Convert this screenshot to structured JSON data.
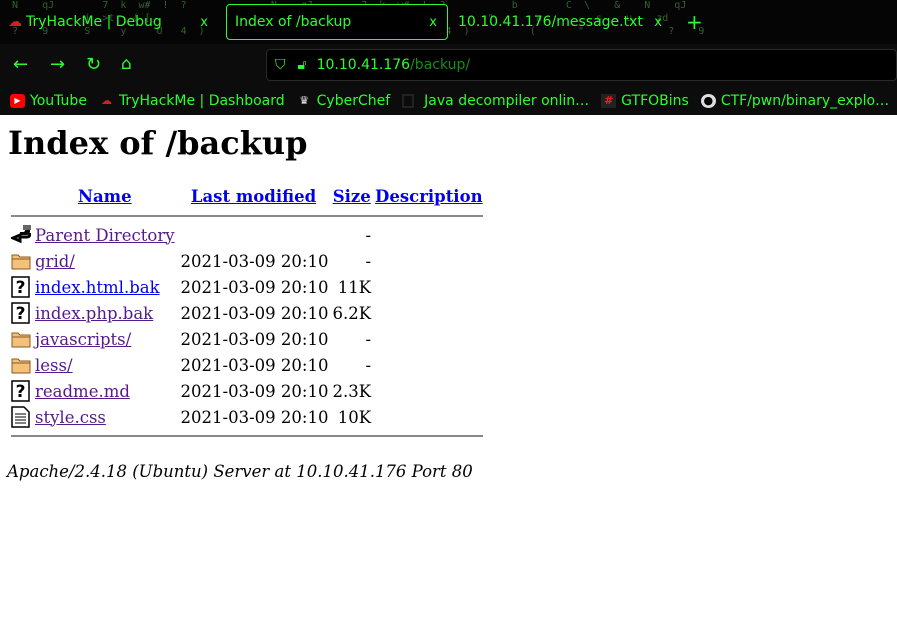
{
  "browser": {
    "tabs": [
      {
        "label": "TryHackMe | Debug",
        "close": "x"
      },
      {
        "label": "Index of /backup",
        "close": "x",
        "active": true
      },
      {
        "label": "10.10.41.176/message.txt",
        "close": "x"
      }
    ],
    "new_tab": "+",
    "url": {
      "host": "10.10.41.176",
      "path": "/backup/"
    },
    "bookmarks": [
      {
        "label": "YouTube",
        "icon": "youtube-icon"
      },
      {
        "label": "TryHackMe | Dashboard",
        "icon": "tryhackme-icon"
      },
      {
        "label": "CyberChef",
        "icon": "cyberchef-icon"
      },
      {
        "label": "Java decompiler onlin…",
        "icon": "java-icon"
      },
      {
        "label": "GTFOBins",
        "icon": "hash-icon"
      },
      {
        "label": "CTF/pwn/binary_explo…",
        "icon": "github-icon"
      }
    ],
    "accent": "#2bff2b"
  },
  "page": {
    "title": "Index of /backup",
    "headers": {
      "name": "Name",
      "modified": "Last modified",
      "size": "Size",
      "description": "Description"
    },
    "rows": [
      {
        "icon": "back",
        "name": "Parent Directory",
        "modified": "",
        "size": "-"
      },
      {
        "icon": "folder",
        "name": "grid/",
        "modified": "2021-03-09 20:10",
        "size": "-"
      },
      {
        "icon": "unknown",
        "name": "index.html.bak",
        "modified": "2021-03-09 20:10",
        "size": "11K"
      },
      {
        "icon": "unknown",
        "name": "index.php.bak",
        "modified": "2021-03-09 20:10",
        "size": "6.2K"
      },
      {
        "icon": "folder",
        "name": "javascripts/",
        "modified": "2021-03-09 20:10",
        "size": "-"
      },
      {
        "icon": "folder",
        "name": "less/",
        "modified": "2021-03-09 20:10",
        "size": "-"
      },
      {
        "icon": "unknown",
        "name": "readme.md",
        "modified": "2021-03-09 20:10",
        "size": "2.3K"
      },
      {
        "icon": "text",
        "name": "style.css",
        "modified": "2021-03-09 20:10",
        "size": "10K"
      }
    ],
    "footer": "Apache/2.4.18 (Ubuntu) Server at 10.10.41.176 Port 80"
  }
}
